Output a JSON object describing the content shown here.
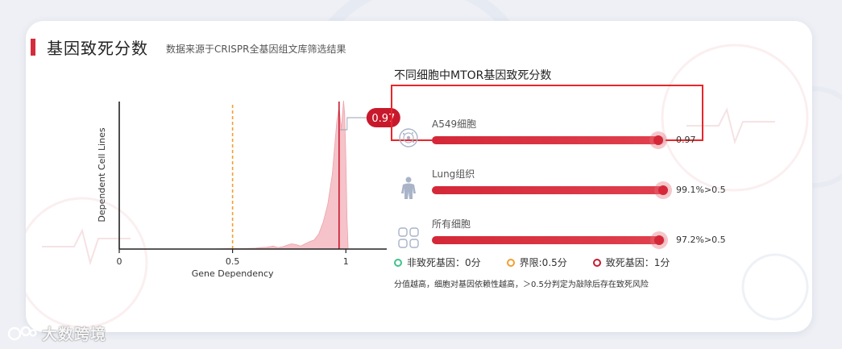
{
  "header": {
    "title": "基因致死分数",
    "subtitle": "数据来源于CRISPR全基因组文库筛选结果"
  },
  "chart_data": {
    "type": "area",
    "xlabel": "Gene Dependency",
    "ylabel": "Dependent Cell Lines",
    "xlim": [
      0,
      1.12
    ],
    "x_ticks": [
      0,
      0.5,
      1
    ],
    "x_tick_labels": [
      "0",
      "0.5",
      "1"
    ],
    "threshold_line": 0.5,
    "marker_value": 0.97,
    "marker_label": "0.97",
    "series": [
      {
        "x": [
          0.4,
          0.45,
          0.5,
          0.55,
          0.6,
          0.62,
          0.65,
          0.68,
          0.7,
          0.72,
          0.74,
          0.76,
          0.78,
          0.8,
          0.82,
          0.84,
          0.86,
          0.88,
          0.9,
          0.92,
          0.94,
          0.95,
          0.96,
          0.97,
          0.98,
          0.985,
          0.99,
          0.995,
          1.0,
          1.005,
          1.01
        ],
        "y": [
          0,
          0.002,
          0.004,
          0.003,
          0.006,
          0.01,
          0.012,
          0.02,
          0.01,
          0.015,
          0.025,
          0.035,
          0.03,
          0.02,
          0.035,
          0.05,
          0.06,
          0.1,
          0.18,
          0.3,
          0.5,
          0.68,
          0.85,
          0.95,
          0.8,
          0.9,
          0.99,
          0.9,
          0.6,
          0.2,
          0
        ]
      }
    ]
  },
  "panel": {
    "title": "不同细胞中MTOR基因致死分数",
    "rows": [
      {
        "label": "A549细胞",
        "value": 0.97,
        "value_text": "0.97",
        "icon": "cell-icon"
      },
      {
        "label": "Lung组织",
        "value": 0.991,
        "value_text": "99.1%>0.5",
        "icon": "human-body-icon"
      },
      {
        "label": "所有细胞",
        "value": 0.972,
        "value_text": "97.2%>0.5",
        "icon": "grid-cells-icon"
      }
    ]
  },
  "legend": {
    "items": [
      {
        "label": "非致死基因：0分",
        "color": "#3fc28c"
      },
      {
        "label": "界限:0.5分",
        "color": "#f0a030"
      },
      {
        "label": "致死基因：1分",
        "color": "#c8192c"
      }
    ],
    "note": "分值越高，细胞对基因依赖性越高，＞0.5分判定为敲除后存在致死风险"
  },
  "colors": {
    "accent": "#d42c3a",
    "area_fill": "#f3b8bf",
    "threshold": "#f0a030",
    "highlight_border": "#e8262a"
  },
  "watermark": {
    "text": "大数跨境"
  }
}
